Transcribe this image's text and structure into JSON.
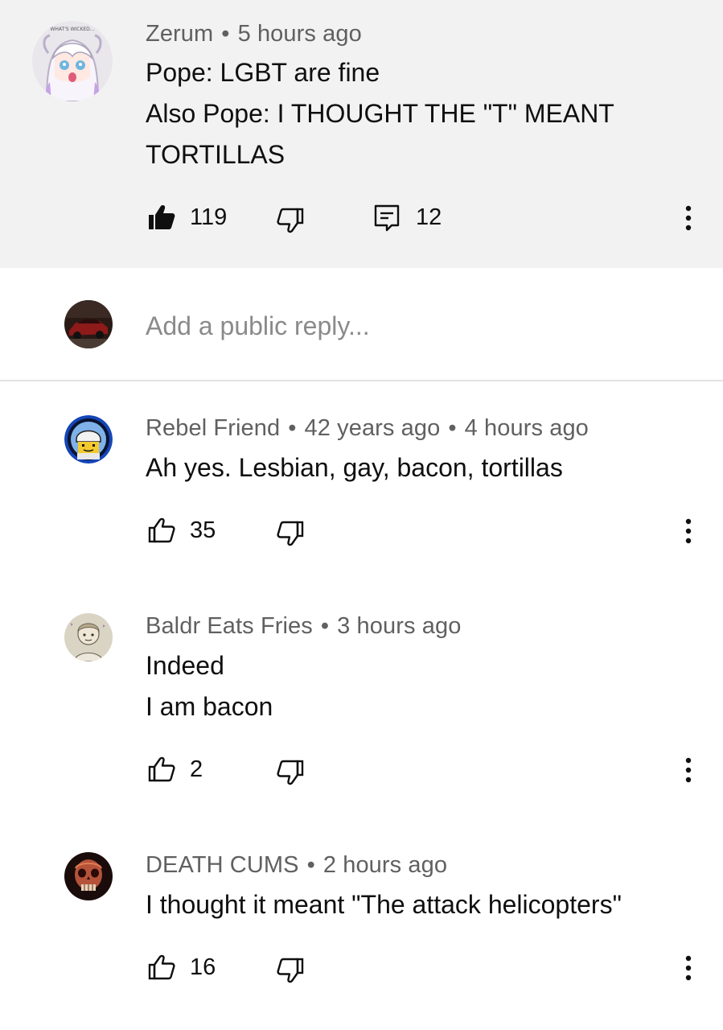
{
  "top_comment": {
    "author": "Zerum",
    "time": "5 hours ago",
    "avatar_caption": "WHAT'S WICKED...",
    "lines": [
      "Pope: LGBT are fine",
      "Also Pope: I THOUGHT THE \"T\" MEANT",
      "TORTILLAS"
    ],
    "likes": "119",
    "replies": "12",
    "liked": true
  },
  "reply_box": {
    "placeholder": "Add a public reply..."
  },
  "replies": [
    {
      "author": "Rebel Friend",
      "handle": "42 years ago",
      "time": "4 hours ago",
      "lines": [
        "Ah yes. Lesbian, gay, bacon, tortillas"
      ],
      "likes": "35"
    },
    {
      "author": "Baldr Eats Fries",
      "time": "3 hours ago",
      "lines": [
        "Indeed",
        "I am bacon"
      ],
      "likes": "2"
    },
    {
      "author": "DEATH CUMS",
      "time": "2 hours ago",
      "lines": [
        "I thought it meant \"The attack helicopters\""
      ],
      "likes": "16"
    }
  ],
  "separator": "•",
  "icons": {
    "like": "thumbs-up-icon",
    "like_filled": "thumbs-up-filled-icon",
    "dislike": "thumbs-down-icon",
    "reply": "comment-icon",
    "more": "more-vert-icon"
  },
  "colors": {
    "header_bg": "#f2f2f2",
    "meta_text": "#606060",
    "body_text": "#0f0f0f",
    "placeholder_text": "#8a8a8a"
  }
}
